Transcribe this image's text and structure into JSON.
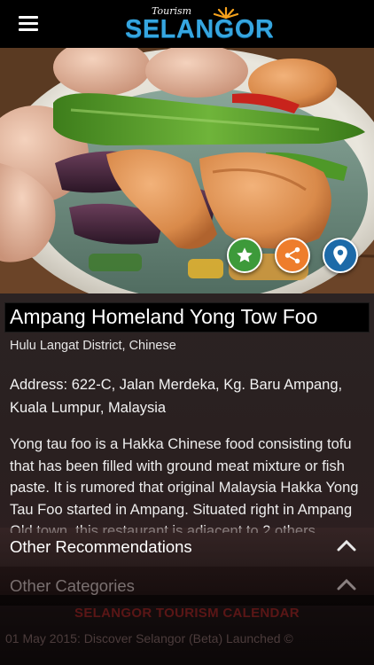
{
  "header": {
    "menu_icon": "hamburger-menu-icon",
    "logo_tourism_text": "Tourism",
    "logo_brand_text": "SELANGOR"
  },
  "hero": {
    "photo_subject": "Yong tow foo dish",
    "actions": {
      "favorite_icon": "star-icon",
      "share_icon": "share-icon",
      "map_icon": "map-pin-icon"
    },
    "colors": {
      "favorite": "#3d9a3a",
      "share": "#ee7d2c",
      "map": "#1d6aa8"
    }
  },
  "listing": {
    "title": "Ampang Homeland Yong Tow Foo",
    "subtitle": "Hulu Langat District, Chinese",
    "address_line1": "Address: 622-C, Jalan Merdeka, Kg. Baru Ampang,",
    "address_line2": "Kuala Lumpur, Malaysia",
    "description": "Yong tau foo is a Hakka Chinese food consisting tofu that has been filled with ground meat mixture or fish paste. It is rumored that original Malaysia Hakka Yong Tau Foo started in Ampang. Situated right in Ampang Old town, this restaurant is adjacent to 2 others"
  },
  "sections": {
    "recommendations_label": "Other Recommendations",
    "categories_label": "Other Categories",
    "chevron_icon": "chevron-up-icon"
  },
  "calendar": {
    "title": "SELANGOR TOURISM CALENDAR",
    "news_item": "01 May 2015: Discover Selangor (Beta) Launched ©"
  }
}
